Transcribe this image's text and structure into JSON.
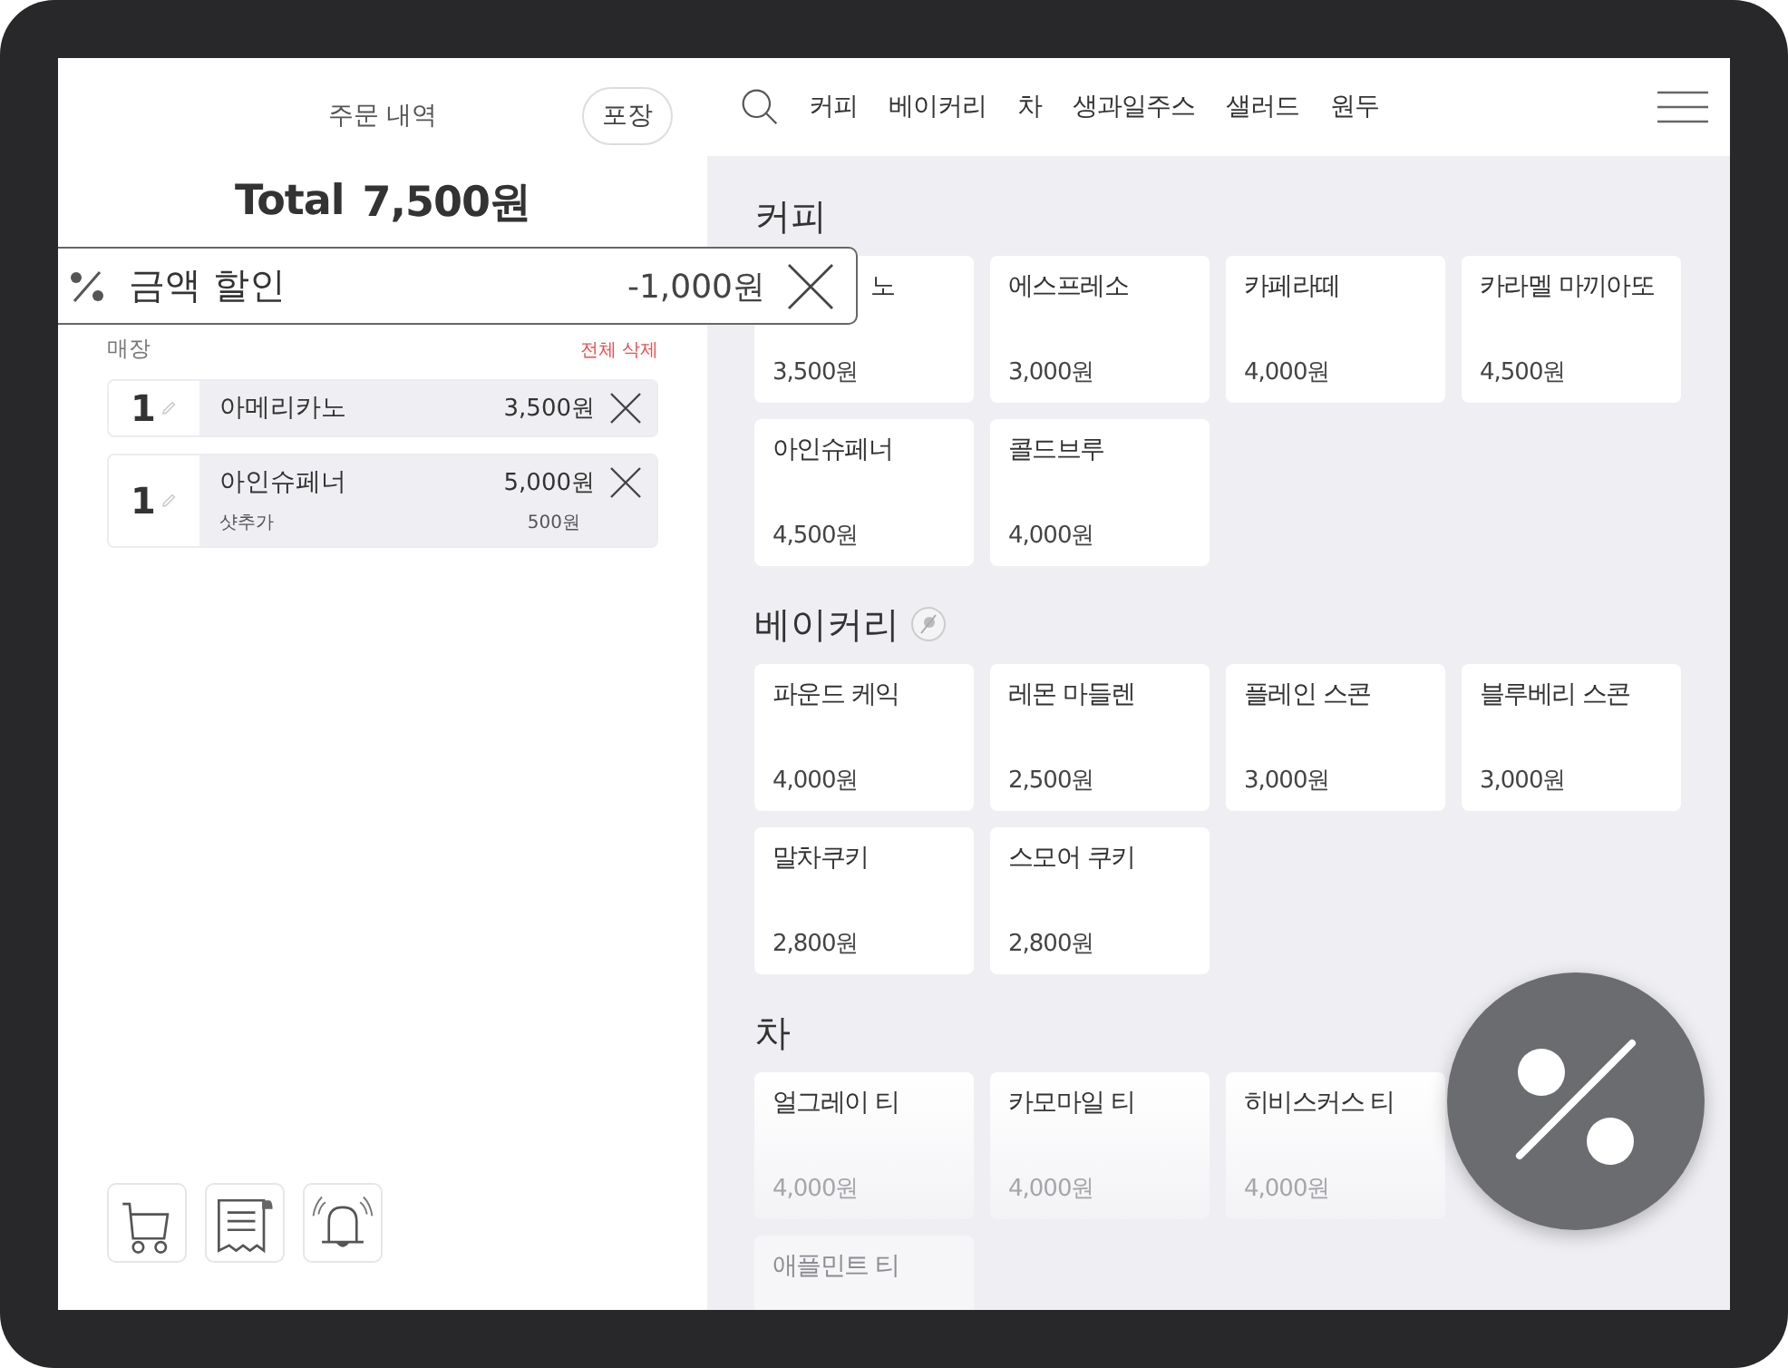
{
  "order_panel": {
    "title": "주문 내역",
    "takeout_button": "포장",
    "total_label": "Total",
    "total_amount": "7,500원",
    "discount": {
      "label": "금액 할인",
      "amount": "-1,000원"
    },
    "section_label": "매장",
    "clear_all": "전체 삭제",
    "items": [
      {
        "qty": "1",
        "name": "아메리카노",
        "price": "3,500원"
      },
      {
        "qty": "1",
        "name": "아인슈페너",
        "price": "5,000원",
        "options": [
          {
            "name": "샷추가",
            "price": "500원"
          }
        ]
      }
    ]
  },
  "nav": {
    "categories": [
      "커피",
      "베이커리",
      "차",
      "생과일주스",
      "샐러드",
      "원두"
    ]
  },
  "menu_sections": [
    {
      "title": "커피",
      "badge": false,
      "items": [
        {
          "name": "노",
          "price": "3,500원",
          "covered": true,
          "faded": false
        },
        {
          "name": "에스프레소",
          "price": "3,000원",
          "covered": false,
          "faded": false
        },
        {
          "name": "카페라떼",
          "price": "4,000원",
          "covered": false,
          "faded": false
        },
        {
          "name": "카라멜 마끼아또",
          "price": "4,500원",
          "covered": false,
          "faded": false
        },
        {
          "name": "아인슈페너",
          "price": "4,500원",
          "covered": false,
          "faded": false
        },
        {
          "name": "콜드브루",
          "price": "4,000원",
          "covered": false,
          "faded": false
        }
      ]
    },
    {
      "title": "베이커리",
      "badge": true,
      "items": [
        {
          "name": "파운드 케익",
          "price": "4,000원",
          "covered": false,
          "faded": false
        },
        {
          "name": "레몬 마들렌",
          "price": "2,500원",
          "covered": false,
          "faded": false
        },
        {
          "name": "플레인 스콘",
          "price": "3,000원",
          "covered": false,
          "faded": false
        },
        {
          "name": "블루베리 스콘",
          "price": "3,000원",
          "covered": false,
          "faded": false
        },
        {
          "name": "말차쿠키",
          "price": "2,800원",
          "covered": false,
          "faded": false
        },
        {
          "name": "스모어 쿠키",
          "price": "2,800원",
          "covered": false,
          "faded": false
        }
      ]
    },
    {
      "title": "차",
      "badge": false,
      "items": [
        {
          "name": "얼그레이 티",
          "price": "4,000원",
          "covered": false,
          "faded": true
        },
        {
          "name": "카모마일 티",
          "price": "4,000원",
          "covered": false,
          "faded": true
        },
        {
          "name": "히비스커스 티",
          "price": "4,000원",
          "covered": false,
          "faded": true
        },
        {
          "name": "애플민트 티",
          "faded": true,
          "row_start": true
        }
      ]
    }
  ]
}
